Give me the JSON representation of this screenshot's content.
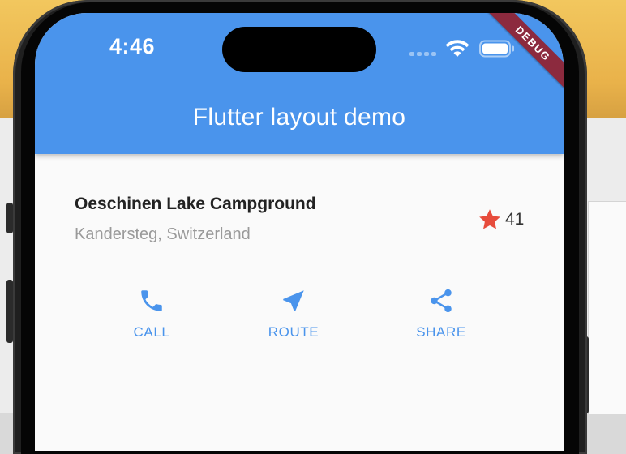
{
  "status_bar": {
    "time": "4:46"
  },
  "debug_banner": {
    "label": "DEBUG",
    "color": "#8c2a3e"
  },
  "app_bar": {
    "title": "Flutter layout demo",
    "color": "#4a94ec"
  },
  "place": {
    "name": "Oeschinen Lake Campground",
    "location": "Kandersteg, Switzerland"
  },
  "rating": {
    "icon": "star-icon",
    "count": "41",
    "color": "#e74c3c"
  },
  "actions": [
    {
      "label": "CALL",
      "icon": "phone-icon"
    },
    {
      "label": "ROUTE",
      "icon": "navigation-icon"
    },
    {
      "label": "SHARE",
      "icon": "share-icon"
    }
  ],
  "accent_color": "#4a94ec"
}
